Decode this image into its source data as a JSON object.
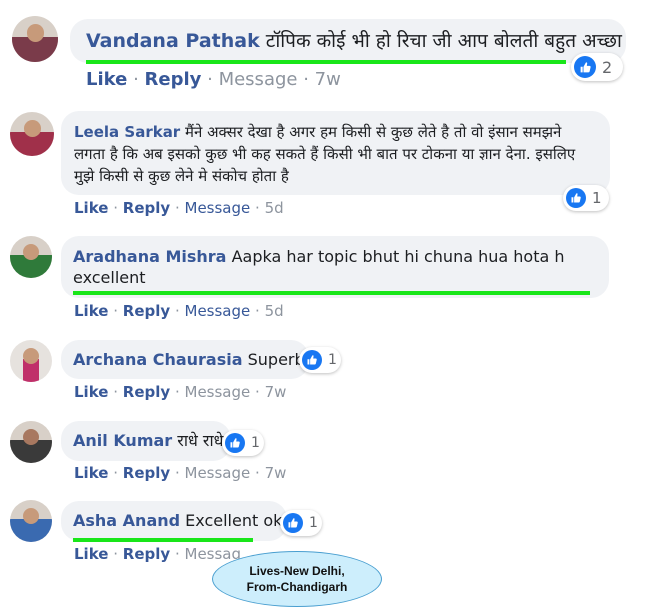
{
  "comments": [
    {
      "name": "Vandana Pathak",
      "text": "टॉपिक कोई भी हो रिचा जी आप बोलती बहुत अच्छा",
      "like": "Like",
      "reply": "Reply",
      "message": "Message",
      "time": "7w",
      "reactions": "2"
    },
    {
      "name": "Leela Sarkar",
      "text": "मैंने अक्सर देखा है अगर हम किसी से कुछ लेते है तो वो इंसान समझने लगता है कि अब इसको कुछ भी कह सकते हैं किसी भी बात पर टोकना या ज्ञान देना. इसलिए मुझे किसी से कुछ लेने मे संकोच होता है",
      "like": "Like",
      "reply": "Reply",
      "message": "Message",
      "time": "5d",
      "reactions": "1"
    },
    {
      "name": "Aradhana Mishra",
      "text": "Aapka har topic bhut hi chuna hua hota h excellent",
      "like": "Like",
      "reply": "Reply",
      "message": "Message",
      "time": "5d"
    },
    {
      "name": "Archana Chaurasia",
      "text": "Superb",
      "like": "Like",
      "reply": "Reply",
      "message": "Message",
      "time": "7w",
      "reactions": "1"
    },
    {
      "name": "Anil Kumar",
      "text": "राधे राधे",
      "like": "Like",
      "reply": "Reply",
      "message": "Message",
      "time": "7w",
      "reactions": "1"
    },
    {
      "name": "Asha Anand",
      "text": "Excellent ok",
      "like": "Like",
      "reply": "Reply",
      "message": "Messag",
      "time": "",
      "reactions": "1"
    }
  ],
  "callout": {
    "line1": "Lives-New Delhi,",
    "line2": "From-Chandigarh"
  },
  "colors": {
    "name": "#385898",
    "bubble": "#f0f2f5",
    "highlight": "#19e619",
    "like_blue": "#1877f2",
    "callout_fill": "#cdeefc"
  }
}
